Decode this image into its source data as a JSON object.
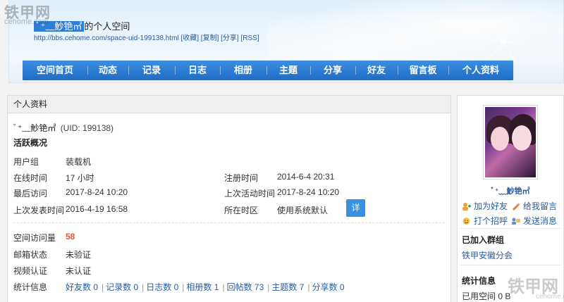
{
  "watermark": {
    "brand": "铁甲网",
    "domain": "cehome.com"
  },
  "header": {
    "nickname": "ﾞ⁺﹏魦铯㎡",
    "title_suffix": "的个人空间",
    "url": "http://bbs.cehome.com/space-uid-199138.html",
    "links": [
      "[收藏]",
      "[复制]",
      "[分享]",
      "[RSS]"
    ]
  },
  "nav": [
    "空间首页",
    "动态",
    "记录",
    "日志",
    "相册",
    "主题",
    "分享",
    "好友",
    "留言板",
    "个人资料"
  ],
  "profile": {
    "panel_title": "个人资料",
    "username": "ﾞ⁺﹏魦铯㎡",
    "uid": "(UID: 199138)",
    "section_title": "活跃概况",
    "user_group_label": "用户组",
    "user_group": "装载机",
    "online_label": "在线时间",
    "online": "17 小时",
    "register_label": "注册时间",
    "register": "2014-6-4 20:31",
    "last_visit_label": "最后访问",
    "last_visit": "2017-8-24 10:20",
    "last_active_label": "上次活动时间",
    "last_active": "2017-8-24 10:20",
    "last_post_label": "上次发表时间",
    "last_post": "2016-4-19 16:58",
    "timezone_label": "所在时区",
    "timezone": "使用系统默认",
    "detail_button": "详",
    "visits_label": "空间访问量",
    "visits": "58",
    "email_label": "邮箱状态",
    "email": "未验证",
    "video_label": "视频认证",
    "video": "未认证",
    "stats_label": "统计信息",
    "stats": [
      "好友数 0",
      "记录数 0",
      "日志数 0",
      "相册数 1",
      "回帖数 73",
      "主题数 7",
      "分享数 0"
    ]
  },
  "sidebar": {
    "nickname": "ﾞ⁺﹏魦铯㎡",
    "add_friend": "加为好友",
    "leave_message": "给我留言",
    "greet": "打个招呼",
    "send_message": "发送消息",
    "groups_title": "已加入群组",
    "group": "铁甲安徽分会",
    "stats_title": "统计信息",
    "used_space": "已用空间 0 B"
  },
  "colors": {
    "nav": "#1e6cc7",
    "link": "#2a5c9a",
    "visits": "#e4572e",
    "button": "#3b8fe0"
  }
}
